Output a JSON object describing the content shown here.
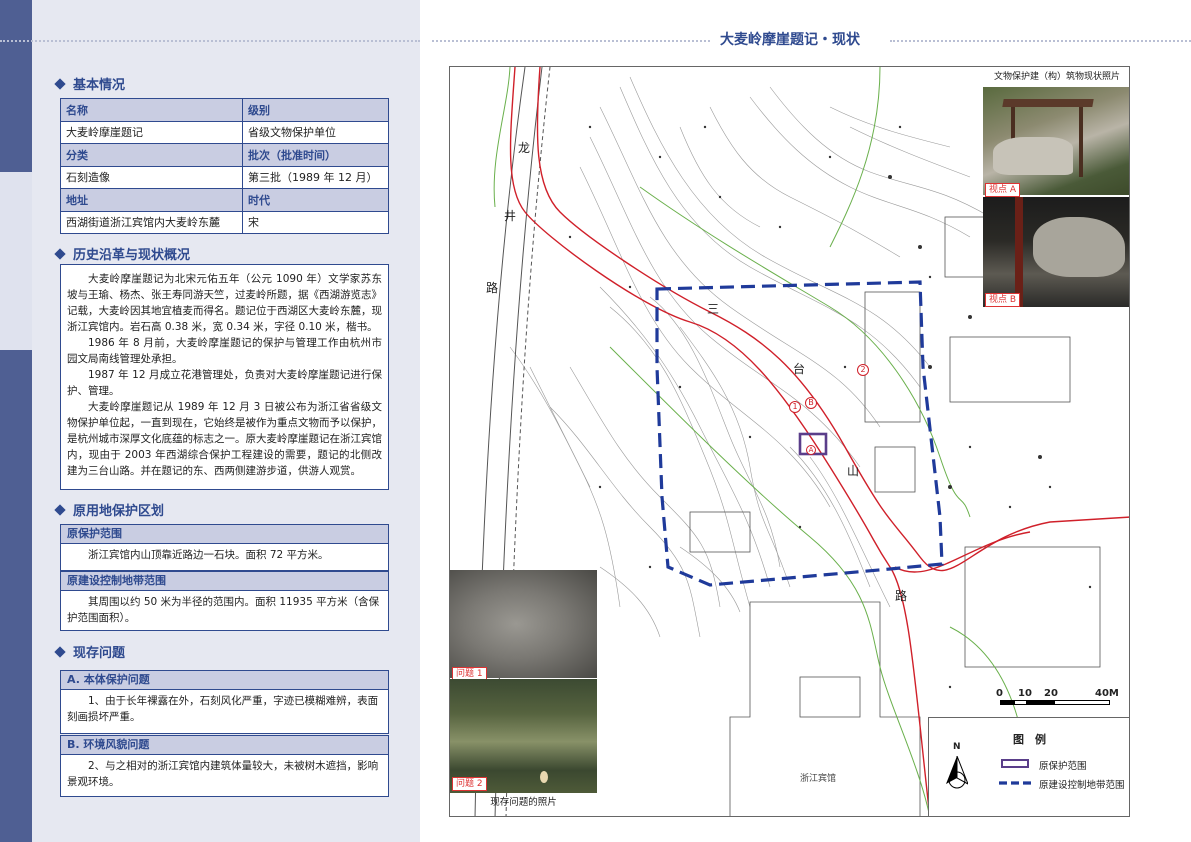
{
  "title": "大麦岭摩崖题记・现状",
  "sections": {
    "basic": "基本情况",
    "history": "历史沿革与现状概况",
    "zone": "原用地保护区划",
    "issues": "现存问题"
  },
  "basic_table": [
    {
      "k1": "名称",
      "k2": "级别"
    },
    {
      "v1": "大麦岭摩崖题记",
      "v2": "省级文物保护单位"
    },
    {
      "k1": "分类",
      "k2": "批次（批准时间）"
    },
    {
      "v1": "石刻造像",
      "v2": "第三批（1989 年 12 月）"
    },
    {
      "k1": "地址",
      "k2": "时代"
    },
    {
      "v1": "西湖街道浙江宾馆内大麦岭东麓",
      "v2": "宋"
    }
  ],
  "history_paras": [
    "大麦岭摩崖题记为北宋元佑五年（公元 1090 年）文学家苏东坡与王瑜、杨杰、张王寿同游天竺，过麦岭所题，据《西湖游览志》记载，大麦岭因其地宜植麦而得名。题记位于西湖区大麦岭东麓，现浙江宾馆内。岩石高 0.38 米，宽 0.34 米，字径 0.10 米，楷书。",
    "1986 年 8 月前，大麦岭摩崖题记的保护与管理工作由杭州市园文局南线管理处承担。",
    "1987 年 12 月成立花港管理处，负责对大麦岭摩崖题记进行保护、管理。",
    "大麦岭摩崖题记从 1989 年 12 月 3 日被公布为浙江省省级文物保护单位起，一直到现在，它始终是被作为重点文物而予以保护，是杭州城市深厚文化底蕴的标志之一。原大麦岭摩崖题记在浙江宾馆内，现由于 2003 年西湖综合保护工程建设的需要，题记的北侧改建为三台山路。并在题记的东、西两侧建游步道，供游人观赏。"
  ],
  "zone": {
    "orig_title": "原保护范围",
    "orig_text": "浙江宾馆内山顶靠近路边一石块。面积 72 平方米。",
    "ctrl_title": "原建设控制地带范围",
    "ctrl_text": "其周围以约 50 米为半径的范围内。面积 11935 平方米（含保护范围面积）。"
  },
  "issues": {
    "a_title": "A. 本体保护问题",
    "a_text": "1、由于长年裸露在外，石刻风化严重，字迹已模糊难辨，表面刻画损坏严重。",
    "b_title": "B. 环境风貌问题",
    "b_text": "2、与之相对的浙江宾馆内建筑体量较大，未被树木遮挡，影响景观环境。"
  },
  "map": {
    "road_longjing": [
      "龙",
      "井",
      "路"
    ],
    "road_santaishan": [
      "三",
      "台",
      "山",
      "路"
    ],
    "hotel": "浙江宾馆",
    "marker_1": "1",
    "marker_2": "2",
    "marker_b": "B",
    "marker_a": "A",
    "photos_title": "文物保护建（构）筑物现状照片",
    "viewpoint_a": "视点 A",
    "viewpoint_b": "视点 B",
    "problem_1": "问题 1",
    "problem_2": "问题 2",
    "problem_caption": "现存问题的照片",
    "scale_labels": [
      "0",
      "10",
      "20",
      "40M"
    ],
    "legend_title": "图　例",
    "north": "N",
    "legend_orig": "原保护范围",
    "legend_ctrl": "原建设控制地带范围"
  },
  "colors": {
    "accent": "#2f4a8f",
    "road_red": "#d0202a",
    "legend_blue": "#1f3a9a",
    "green_line": "#6ab04c"
  }
}
